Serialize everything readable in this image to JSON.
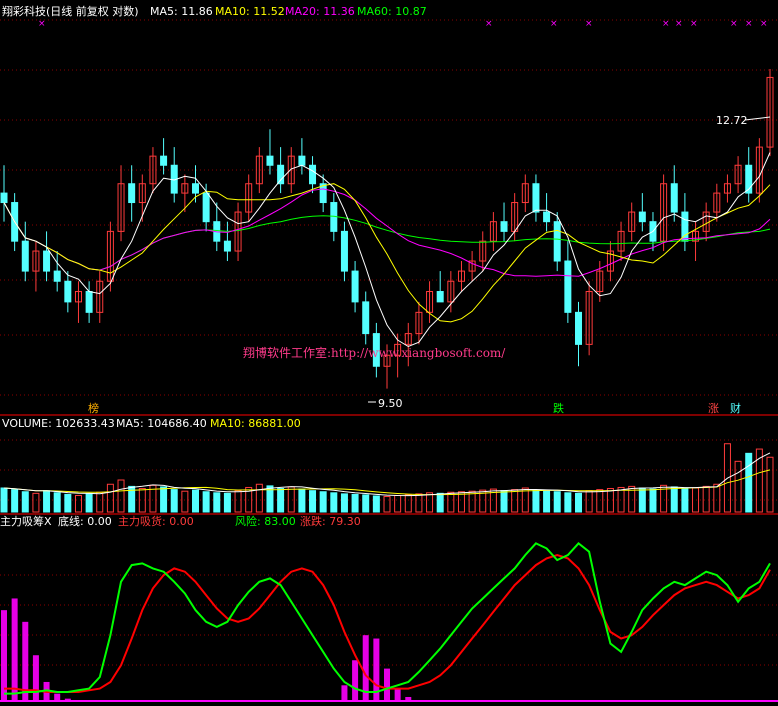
{
  "colors": {
    "bg": "#000000",
    "up": "#ff3b3b",
    "down": "#54ffff",
    "ma5": "#ffffff",
    "ma10": "#ffff00",
    "ma20": "#ff00ff",
    "ma60": "#00ff00",
    "grid": "#8b0000",
    "green_line": "#00ff00",
    "red_line": "#ff0000",
    "magenta": "#ff00ff"
  },
  "header": {
    "title": "翔彩科技(日线 前复权 对数)",
    "ma5_label": "MA5: 11.86",
    "ma10_label": "MA10: 11.52",
    "ma20_label": "MA20: 11.36",
    "ma60_label": "MA60: 10.87"
  },
  "annotations": {
    "high_price": "12.72",
    "low_price": "9.50",
    "watermark": "翔博软件工作室:http://www.xiangbosoft.com/",
    "markers": [
      "榜",
      "跌",
      "涨",
      "财"
    ]
  },
  "volume_header": {
    "volume_label": "VOLUME: 102633.43",
    "ma5_label": "MA5: 104686.40",
    "ma10_label": "MA10: 86881.00"
  },
  "indicator_header": {
    "name": "主力吸筹X",
    "bottom_label": "底线: 0.00",
    "accumulate_label": "主力吸货: 0.00",
    "risk_label": "风险: 83.00",
    "rise_fall_label": "涨跌: 79.30"
  },
  "chart_data": [
    {
      "type": "candlestick",
      "title": "翔彩科技(日线 前复权 对数)",
      "ylim": [
        9.3,
        13.3
      ],
      "y_scale": "log",
      "grid": true,
      "candles": [
        [
          11.3,
          11.6,
          11.0,
          11.2
        ],
        [
          11.2,
          11.3,
          10.7,
          10.8
        ],
        [
          10.8,
          11.0,
          10.4,
          10.5
        ],
        [
          10.5,
          10.8,
          10.3,
          10.7
        ],
        [
          10.7,
          10.9,
          10.4,
          10.5
        ],
        [
          10.5,
          10.7,
          10.3,
          10.4
        ],
        [
          10.4,
          10.5,
          10.1,
          10.2
        ],
        [
          10.2,
          10.4,
          10.0,
          10.3
        ],
        [
          10.3,
          10.4,
          10.0,
          10.1
        ],
        [
          10.1,
          10.5,
          10.0,
          10.4
        ],
        [
          10.4,
          11.0,
          10.3,
          10.9
        ],
        [
          10.9,
          11.6,
          10.8,
          11.4
        ],
        [
          11.4,
          11.6,
          11.0,
          11.2
        ],
        [
          11.2,
          11.5,
          11.0,
          11.4
        ],
        [
          11.4,
          11.8,
          11.3,
          11.7
        ],
        [
          11.7,
          11.9,
          11.5,
          11.6
        ],
        [
          11.6,
          11.8,
          11.2,
          11.3
        ],
        [
          11.3,
          11.5,
          11.1,
          11.4
        ],
        [
          11.4,
          11.6,
          11.2,
          11.3
        ],
        [
          11.3,
          11.4,
          10.9,
          11.0
        ],
        [
          11.0,
          11.2,
          10.7,
          10.8
        ],
        [
          10.8,
          11.0,
          10.6,
          10.7
        ],
        [
          10.7,
          11.2,
          10.6,
          11.1
        ],
        [
          11.1,
          11.5,
          11.0,
          11.4
        ],
        [
          11.4,
          11.8,
          11.3,
          11.7
        ],
        [
          11.7,
          12.0,
          11.5,
          11.6
        ],
        [
          11.6,
          11.8,
          11.3,
          11.4
        ],
        [
          11.4,
          11.8,
          11.3,
          11.7
        ],
        [
          11.7,
          11.9,
          11.5,
          11.6
        ],
        [
          11.6,
          11.7,
          11.3,
          11.4
        ],
        [
          11.4,
          11.5,
          11.1,
          11.2
        ],
        [
          11.2,
          11.3,
          10.8,
          10.9
        ],
        [
          10.9,
          11.0,
          10.4,
          10.5
        ],
        [
          10.5,
          10.6,
          10.1,
          10.2
        ],
        [
          10.2,
          10.3,
          9.8,
          9.9
        ],
        [
          9.9,
          10.0,
          9.5,
          9.6
        ],
        [
          9.6,
          9.8,
          9.4,
          9.7
        ],
        [
          9.7,
          9.9,
          9.5,
          9.8
        ],
        [
          9.8,
          10.0,
          9.6,
          9.9
        ],
        [
          9.9,
          10.2,
          9.8,
          10.1
        ],
        [
          10.1,
          10.4,
          10.0,
          10.3
        ],
        [
          10.3,
          10.5,
          10.2,
          10.2
        ],
        [
          10.2,
          10.5,
          10.1,
          10.4
        ],
        [
          10.4,
          10.6,
          10.3,
          10.5
        ],
        [
          10.5,
          10.7,
          10.4,
          10.6
        ],
        [
          10.6,
          10.9,
          10.5,
          10.8
        ],
        [
          10.8,
          11.1,
          10.7,
          11.0
        ],
        [
          11.0,
          11.2,
          10.8,
          10.9
        ],
        [
          10.9,
          11.3,
          10.8,
          11.2
        ],
        [
          11.2,
          11.5,
          11.1,
          11.4
        ],
        [
          11.4,
          11.5,
          11.0,
          11.1
        ],
        [
          11.1,
          11.3,
          10.9,
          11.0
        ],
        [
          11.0,
          11.1,
          10.5,
          10.6
        ],
        [
          10.6,
          10.8,
          10.0,
          10.1
        ],
        [
          10.1,
          10.2,
          9.6,
          9.8
        ],
        [
          9.8,
          10.4,
          9.7,
          10.3
        ],
        [
          10.3,
          10.6,
          10.2,
          10.5
        ],
        [
          10.5,
          10.8,
          10.4,
          10.7
        ],
        [
          10.7,
          11.0,
          10.6,
          10.9
        ],
        [
          10.9,
          11.2,
          10.8,
          11.1
        ],
        [
          11.1,
          11.3,
          10.9,
          11.0
        ],
        [
          11.0,
          11.1,
          10.7,
          10.8
        ],
        [
          10.8,
          11.5,
          10.7,
          11.4
        ],
        [
          11.4,
          11.6,
          11.0,
          11.1
        ],
        [
          11.1,
          11.3,
          10.7,
          10.8
        ],
        [
          10.8,
          11.0,
          10.6,
          10.9
        ],
        [
          10.9,
          11.2,
          10.8,
          11.1
        ],
        [
          11.1,
          11.4,
          11.0,
          11.3
        ],
        [
          11.3,
          11.5,
          11.2,
          11.4
        ],
        [
          11.4,
          11.7,
          11.3,
          11.6
        ],
        [
          11.6,
          11.8,
          11.2,
          11.3
        ],
        [
          11.3,
          11.9,
          11.2,
          11.8
        ],
        [
          11.8,
          12.7,
          11.7,
          12.6
        ]
      ],
      "ma_series": [
        {
          "name": "MA5",
          "last": 11.86
        },
        {
          "name": "MA10",
          "last": 11.52
        },
        {
          "name": "MA20",
          "last": 11.36
        },
        {
          "name": "MA60",
          "last": 10.87
        }
      ]
    },
    {
      "type": "bar",
      "title": "VOLUME",
      "ylim": [
        0,
        150000
      ],
      "values": [
        45000,
        42000,
        38000,
        35000,
        40000,
        36000,
        33000,
        31000,
        34000,
        37000,
        52000,
        60000,
        48000,
        44000,
        50000,
        47000,
        42000,
        39000,
        41000,
        38000,
        36000,
        35000,
        40000,
        46000,
        52000,
        49000,
        44000,
        47000,
        43000,
        40000,
        38000,
        36000,
        34000,
        33000,
        32000,
        30000,
        29000,
        31000,
        32000,
        34000,
        36000,
        35000,
        37000,
        38000,
        39000,
        41000,
        43000,
        40000,
        42000,
        45000,
        41000,
        39000,
        38000,
        36000,
        35000,
        40000,
        42000,
        44000,
        46000,
        48000,
        45000,
        43000,
        50000,
        47000,
        44000,
        45000,
        48000,
        52000,
        128000,
        95000,
        110000,
        118000,
        102633
      ],
      "ma_series": [
        {
          "name": "MA5",
          "last": 104686.4
        },
        {
          "name": "MA10",
          "last": 86881.0
        }
      ]
    },
    {
      "type": "line",
      "title": "主力吸筹X",
      "ylim": [
        0,
        100
      ],
      "series": [
        {
          "name": "风险",
          "values": [
            5,
            5,
            6,
            6,
            7,
            6,
            6,
            7,
            8,
            15,
            40,
            72,
            82,
            83,
            80,
            78,
            72,
            65,
            55,
            48,
            45,
            48,
            58,
            66,
            72,
            74,
            70,
            60,
            50,
            40,
            30,
            20,
            12,
            8,
            6,
            6,
            8,
            10,
            12,
            18,
            25,
            32,
            40,
            48,
            56,
            62,
            68,
            74,
            80,
            88,
            95,
            92,
            85,
            88,
            95,
            90,
            60,
            35,
            30,
            42,
            55,
            62,
            68,
            72,
            70,
            74,
            78,
            76,
            70,
            60,
            68,
            72,
            83
          ]
        },
        {
          "name": "涨跌",
          "values": [
            8,
            8,
            7,
            7,
            6,
            6,
            6,
            6,
            7,
            8,
            12,
            22,
            38,
            55,
            68,
            76,
            80,
            78,
            72,
            64,
            56,
            50,
            48,
            50,
            56,
            64,
            72,
            78,
            80,
            78,
            70,
            58,
            42,
            28,
            16,
            10,
            8,
            8,
            8,
            10,
            12,
            16,
            22,
            30,
            38,
            46,
            54,
            62,
            70,
            76,
            82,
            86,
            88,
            86,
            80,
            70,
            55,
            42,
            38,
            40,
            45,
            52,
            58,
            64,
            68,
            70,
            72,
            70,
            66,
            62,
            64,
            68,
            79.3
          ]
        },
        {
          "name": "主力吸货",
          "values": [
            55,
            62,
            48,
            28,
            12,
            5,
            2,
            1,
            0,
            0,
            0,
            0,
            0,
            0,
            0,
            0,
            0,
            0,
            0,
            0,
            0,
            0,
            0,
            0,
            0,
            0,
            0,
            0,
            0,
            0,
            0,
            0,
            10,
            25,
            40,
            38,
            20,
            8,
            3,
            1,
            0,
            0,
            0,
            0,
            0,
            0,
            0,
            0,
            0,
            0,
            0,
            0,
            0,
            0,
            0,
            0,
            0,
            0,
            0,
            0,
            0,
            0,
            0,
            0,
            0,
            0,
            0,
            0,
            0,
            0,
            0,
            0,
            0
          ]
        }
      ]
    }
  ]
}
